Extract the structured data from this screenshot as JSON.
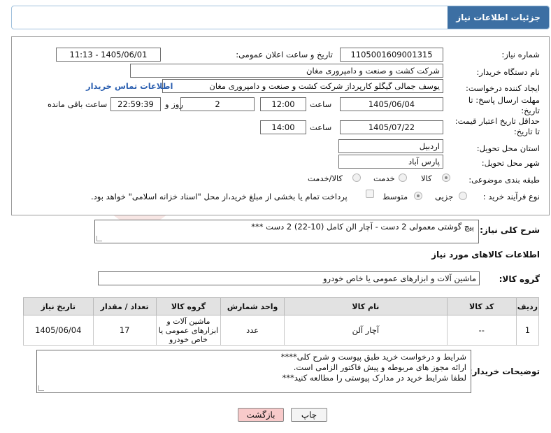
{
  "header": {
    "title": "جزئیات اطلاعات نیاز"
  },
  "form": {
    "need_number_label": "شماره نیاز:",
    "need_number": "1105001609001315",
    "announce_label": "تاریخ و ساعت اعلان عمومی:",
    "announce_value": "1405/06/01 - 11:13",
    "buyer_org_label": "نام دستگاه خریدار:",
    "buyer_org": "شرکت کشت و صنعت و دامپروری مغان",
    "requester_label": "ایجاد کننده درخواست:",
    "requester": "یوسف جمالی گیگلو کارپرداز شرکت کشت و صنعت و دامپروری مغان",
    "contact_link": "اطلاعات تماس خریدار",
    "deadline_label": "مهلت ارسال پاسخ: تا تاریخ:",
    "deadline_date": "1405/06/04",
    "time_label": "ساعت",
    "deadline_time": "12:00",
    "days_value": "2",
    "days_label": "روز و",
    "remaining_time": "22:59:39",
    "remaining_label": "ساعت باقی مانده",
    "price_validity_label": "حداقل تاریخ اعتبار قیمت: تا تاریخ:",
    "price_validity_date": "1405/07/22",
    "price_validity_time": "14:00",
    "province_label": "استان محل تحویل:",
    "province": "اردبیل",
    "city_label": "شهر محل تحویل:",
    "city": "پارس آباد",
    "category_label": "طبقه بندی موضوعی:",
    "category_options": [
      "کالا",
      "خدمت",
      "کالا/خدمت"
    ],
    "process_label": "نوع فرآیند خرید :",
    "process_options": [
      "جزیی",
      "متوسط"
    ],
    "payment_note": "پرداخت تمام یا بخشی از مبلغ خرید،از محل \"اسناد خزانه اسلامی\" خواهد بود."
  },
  "description": {
    "label": "شرح کلی نیاز:",
    "text": "پیچ گوشتی معمولی 2 دست - آچار الن کامل (10-22) 2 دست ***"
  },
  "goods": {
    "section_title": "اطلاعات کالاهای مورد نیاز",
    "group_label": "گروه کالا:",
    "group_value": "ماشین آلات و ابزارهای عمومی یا خاص خودرو",
    "columns": [
      "ردیف",
      "کد کالا",
      "نام کالا",
      "واحد شمارش",
      "گروه کالا",
      "تعداد / مقدار",
      "تاریخ نیاز"
    ],
    "rows": [
      {
        "row": "1",
        "code": "--",
        "name": "آچار آلن",
        "unit": "عدد",
        "group": "ماشین آلات و ابزارهای عمومی یا خاص خودرو",
        "qty": "17",
        "date": "1405/06/04"
      }
    ]
  },
  "buyer_notes": {
    "label": "توضیحات خریدار:",
    "line1": "شرایط و درخواست خرید طبق پیوست و شرح کلی****",
    "line2": "ارائه مجوز های مربوطه و پیش فاکتور الزامی است.",
    "line3": "لطفا شرایط خرید در مدارک پیوستی را مطالعه کنید***"
  },
  "buttons": {
    "print": "چاپ",
    "back": "بازگشت"
  },
  "colors": {
    "title_bg": "#3c6fa3",
    "link": "#2b5fb0",
    "back_button": "#f8caca"
  }
}
